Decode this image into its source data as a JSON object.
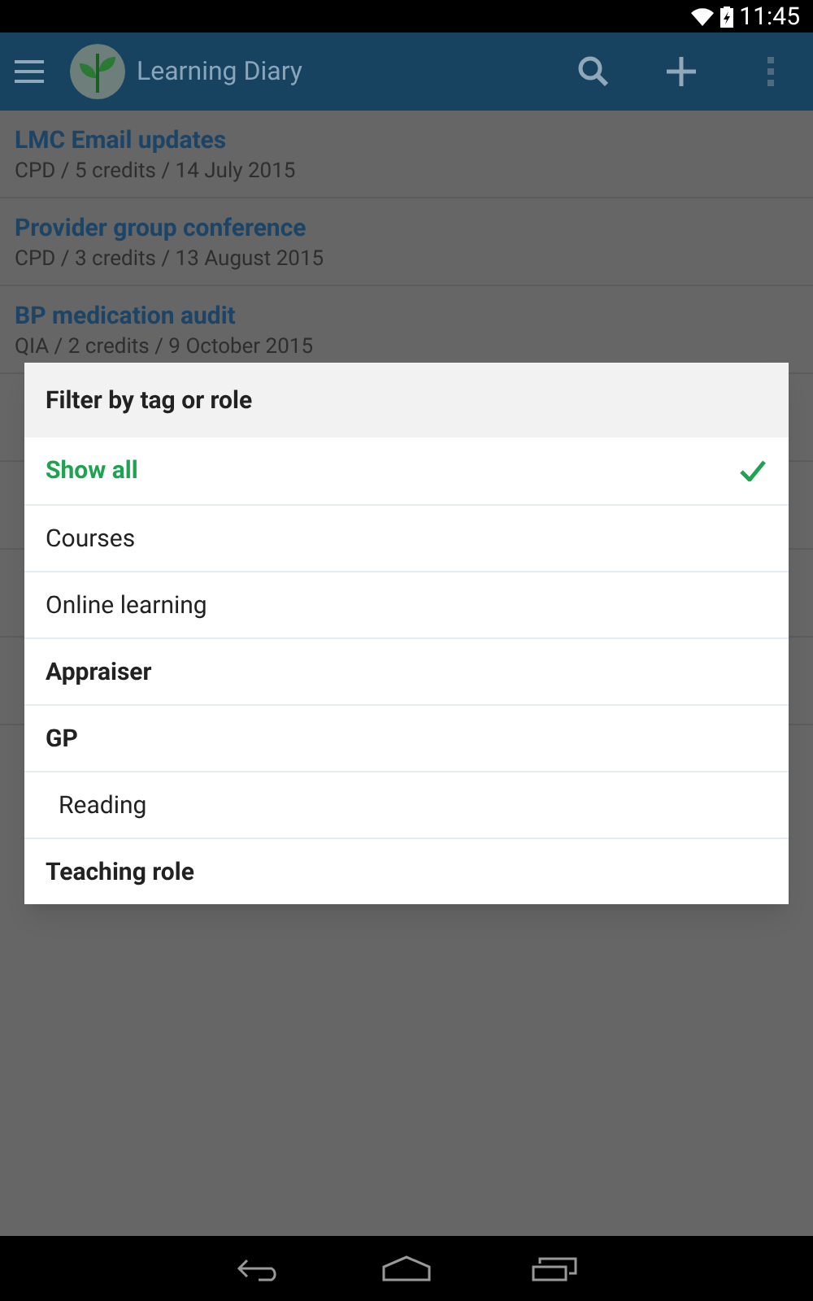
{
  "status_bar": {
    "time": "11:45"
  },
  "app_bar": {
    "title": "Learning Diary"
  },
  "entries": [
    {
      "title": "LMC Email updates",
      "subtitle": "CPD / 5 credits / 14 July 2015"
    },
    {
      "title": "Provider group conference",
      "subtitle": "CPD / 3 credits / 13 August 2015"
    },
    {
      "title": "BP medication audit",
      "subtitle": "QIA / 2 credits / 9 October 2015"
    }
  ],
  "dialog": {
    "title": "Filter by tag or role",
    "options": [
      {
        "label": "Show all",
        "kind": "all",
        "selected": true
      },
      {
        "label": "Courses",
        "kind": "tag",
        "selected": false
      },
      {
        "label": "Online learning",
        "kind": "tag",
        "selected": false
      },
      {
        "label": "Appraiser",
        "kind": "role",
        "selected": false
      },
      {
        "label": "GP",
        "kind": "role",
        "selected": false,
        "children": [
          {
            "label": "Reading",
            "kind": "tag",
            "selected": false
          }
        ]
      },
      {
        "label": "Teaching role",
        "kind": "role",
        "selected": false
      }
    ]
  }
}
